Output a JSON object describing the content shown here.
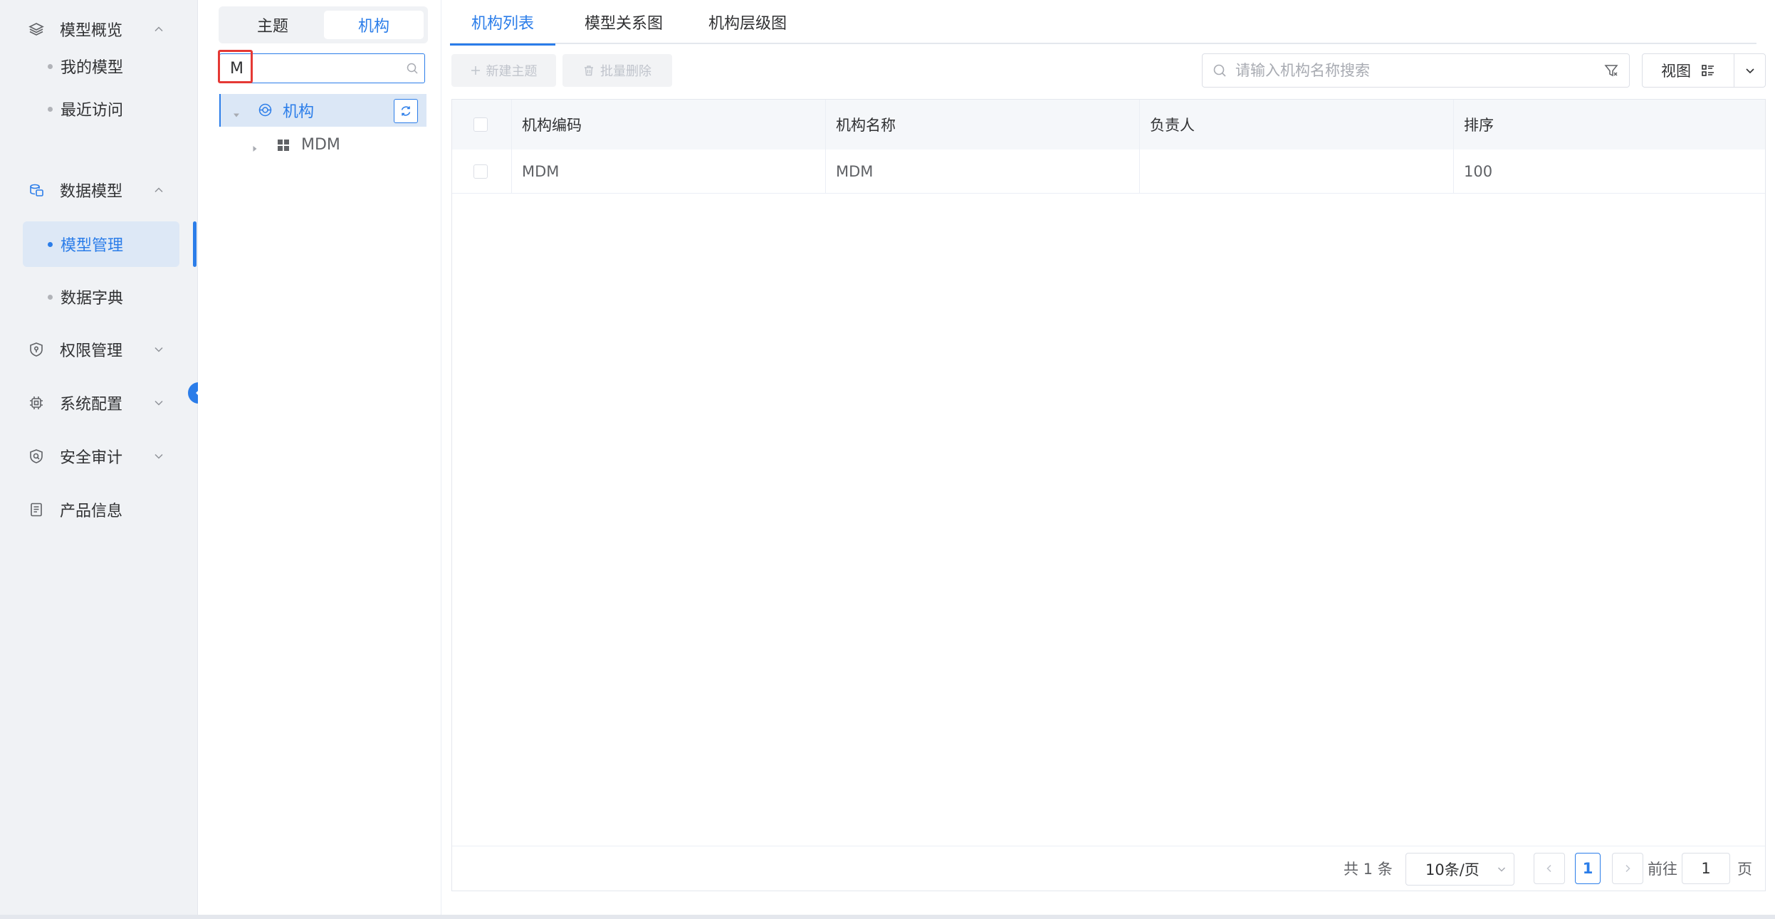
{
  "sidebar": {
    "groups": [
      {
        "label": "模型概览",
        "icon": "layers-icon",
        "expanded": true,
        "children": [
          {
            "label": "我的模型"
          },
          {
            "label": "最近访问"
          }
        ]
      },
      {
        "label": "数据模型",
        "icon": "database-icon",
        "expanded": true,
        "children": [
          {
            "label": "模型管理",
            "active": true
          },
          {
            "label": "数据字典"
          }
        ]
      },
      {
        "label": "权限管理",
        "icon": "shield-key-icon",
        "expanded": false
      },
      {
        "label": "系统配置",
        "icon": "chip-icon",
        "expanded": false
      },
      {
        "label": "安全审计",
        "icon": "shield-audit-icon",
        "expanded": false
      },
      {
        "label": "产品信息",
        "icon": "document-icon"
      }
    ]
  },
  "tree": {
    "segment": {
      "tab_topic": "主题",
      "tab_org": "机构",
      "active": "机构"
    },
    "search_value": "M",
    "root": {
      "label": "机构",
      "icon": "org-icon"
    },
    "children": [
      {
        "label": "MDM",
        "icon": "grid-icon"
      }
    ]
  },
  "main": {
    "tabs": [
      {
        "label": "机构列表",
        "active": true
      },
      {
        "label": "模型关系图"
      },
      {
        "label": "机构层级图"
      }
    ],
    "toolbar": {
      "new_label": "新建主题",
      "batch_delete_label": "批量删除",
      "search_placeholder": "请输入机构名称搜索",
      "view_label": "视图"
    },
    "table": {
      "columns": [
        "机构编码",
        "机构名称",
        "负责人",
        "排序"
      ],
      "rows": [
        {
          "code": "MDM",
          "name": "MDM",
          "owner": "",
          "order": "100"
        }
      ]
    },
    "pagination": {
      "total_text": "共 1 条",
      "page_size": "10条/页",
      "current_page": "1",
      "goto_prefix": "前往",
      "goto_value": "1",
      "goto_suffix": "页"
    }
  },
  "colors": {
    "accent": "#2b7de9",
    "highlight_box": "#e53935",
    "sidebar_bg": "#f0f2f5"
  }
}
